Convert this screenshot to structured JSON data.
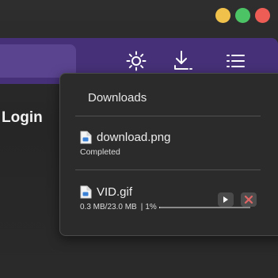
{
  "page": {
    "login_partial": "Login"
  },
  "toolbar": {
    "icons": [
      "sun-icon",
      "download-icon",
      "menu-icon"
    ]
  },
  "downloads": {
    "title": "Downloads",
    "items": [
      {
        "name": "download.png",
        "status": "Completed"
      },
      {
        "name": "VID.gif",
        "size_progress": "0.3 MB/23.0 MB",
        "separator": "|",
        "percent_text": "1%",
        "progress_fraction": 0.01
      }
    ]
  },
  "colors": {
    "appbar": "#463178",
    "cancel_icon": "#e06666"
  }
}
